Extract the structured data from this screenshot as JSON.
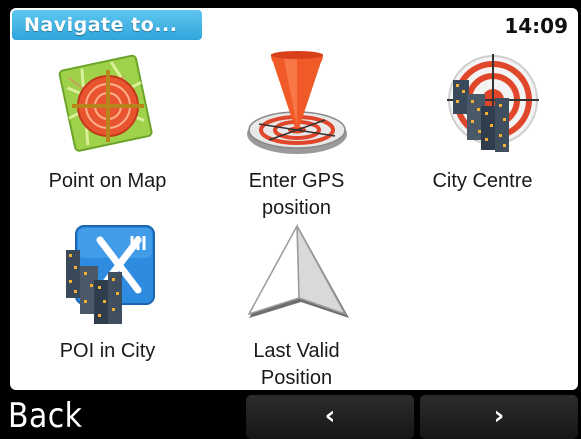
{
  "header": {
    "title": "Navigate to...",
    "time": "14:09"
  },
  "menu": {
    "items": [
      {
        "label": "Point on Map",
        "icon": "map-target-icon"
      },
      {
        "label": "Enter GPS\nposition",
        "icon": "gps-pin-target-icon"
      },
      {
        "label": "City Centre",
        "icon": "city-target-icon"
      },
      {
        "label": "POI in City",
        "icon": "poi-city-restaurant-icon"
      },
      {
        "label": "Last Valid\nPosition",
        "icon": "last-position-arrow-icon"
      }
    ]
  },
  "footer": {
    "back_label": "Back",
    "prev_label": "‹",
    "next_label": "›"
  },
  "colors": {
    "title_bg": "#3BB0E3",
    "target_red": "#E0462A",
    "background": "#000000"
  }
}
